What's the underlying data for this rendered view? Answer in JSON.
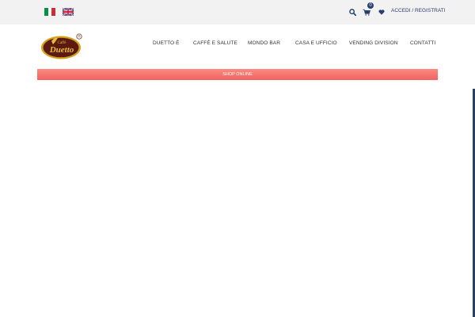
{
  "languages": {
    "it_label": "Italiano",
    "en_label": "English",
    "it_colors": [
      "#009246",
      "#ffffff",
      "#ce2b37"
    ],
    "en_colors": [
      "#012169",
      "#ffffff",
      "#c8102e"
    ]
  },
  "utility": {
    "search_icon": "search-icon",
    "cart_icon": "cart-icon",
    "cart_count": "0",
    "wishlist_icon": "heart-icon",
    "account_label": "ACCEDI / REGISTRATI"
  },
  "logo": {
    "brand_text": "Duetto",
    "small_text": "Caffè",
    "trademark": "®",
    "colors": {
      "outer": "#d4a017",
      "inner": "#5a1a10",
      "text": "#e8b93a"
    }
  },
  "nav": {
    "items": [
      {
        "label": "DUETTO È"
      },
      {
        "label": "CAFFÈ E SALUTE"
      },
      {
        "label": "MONDO BAR"
      },
      {
        "label": "CASA E UFFICIO"
      },
      {
        "label": "VENDING DIVISION"
      },
      {
        "label": "CONTATTI"
      }
    ]
  },
  "shop": {
    "label": "SHOP ONLINE",
    "color": "#f47470"
  },
  "theme": {
    "accent": "#27406f",
    "topbar_bg": "#f2f2f2"
  }
}
